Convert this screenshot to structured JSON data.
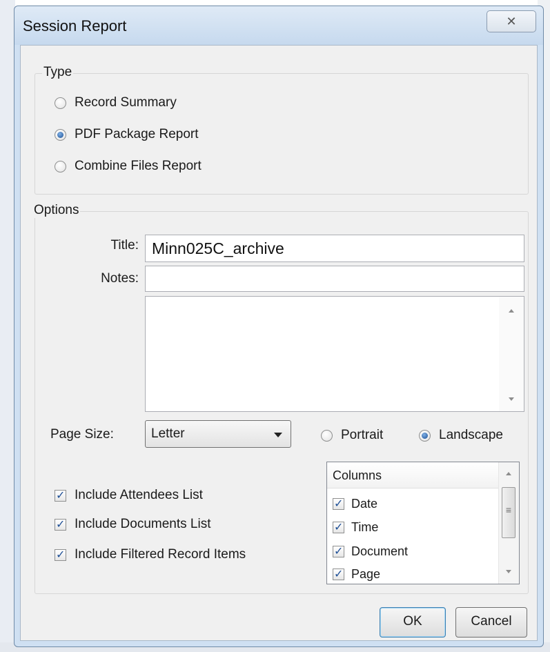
{
  "dialog": {
    "title": "Session Report",
    "close_glyph": "✕"
  },
  "type_group": {
    "label": "Type",
    "options": [
      {
        "label": "Record Summary",
        "selected": false
      },
      {
        "label": "PDF Package Report",
        "selected": true
      },
      {
        "label": "Combine Files Report",
        "selected": false
      }
    ]
  },
  "options_group": {
    "label": "Options",
    "title_label": "Title:",
    "title_value": "Minn025C_archive",
    "notes_label": "Notes:",
    "notes_value": "",
    "page_size_label": "Page Size:",
    "page_size_value": "Letter",
    "orientation": [
      {
        "label": "Portrait",
        "selected": false
      },
      {
        "label": "Landscape",
        "selected": true
      }
    ],
    "checkboxes": [
      {
        "label": "Include Attendees List",
        "checked": true
      },
      {
        "label": "Include Documents List",
        "checked": true
      },
      {
        "label": "Include Filtered Record Items",
        "checked": true
      }
    ],
    "columns": {
      "header": "Columns",
      "items": [
        {
          "label": "Date",
          "checked": true
        },
        {
          "label": "Time",
          "checked": true
        },
        {
          "label": "Document",
          "checked": true
        },
        {
          "label": "Page",
          "checked": true
        }
      ]
    }
  },
  "buttons": {
    "ok": "OK",
    "cancel": "Cancel"
  }
}
